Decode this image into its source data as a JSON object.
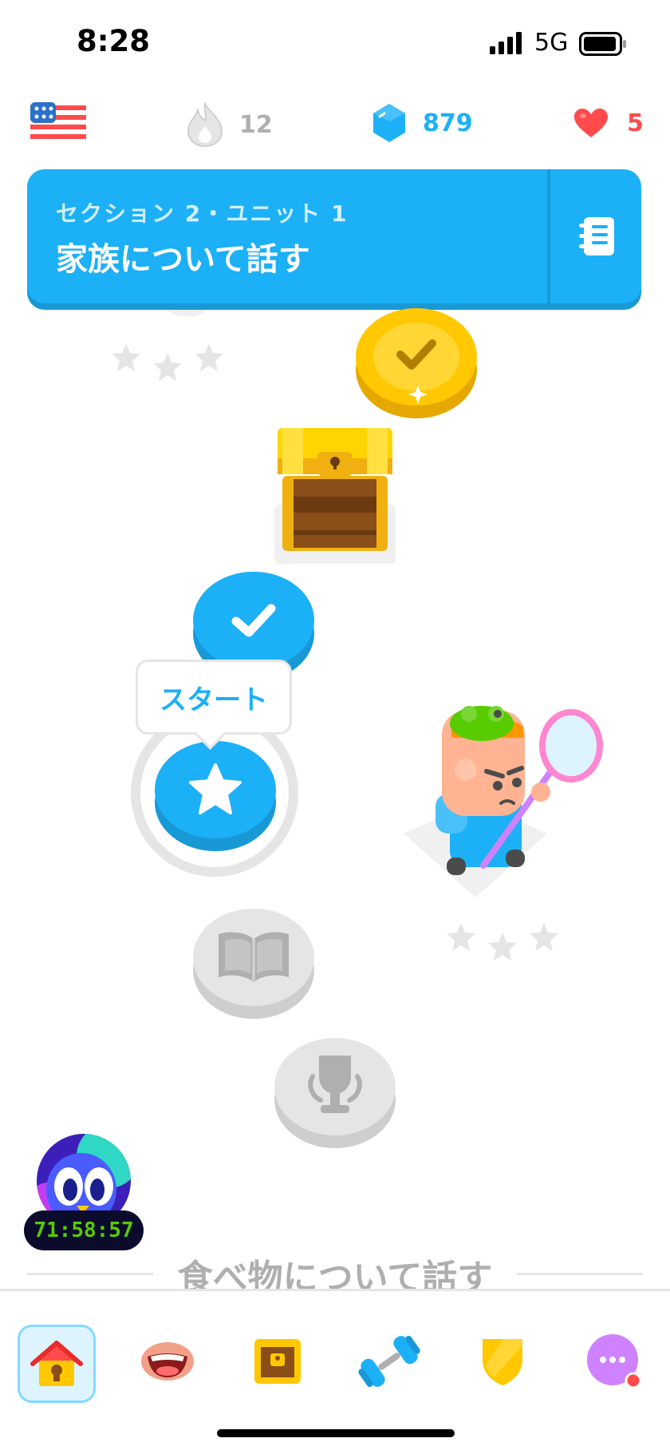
{
  "status_bar": {
    "time": "8:28",
    "network": "5G"
  },
  "top_stats": {
    "language_flag": "us-flag-icon",
    "streak": "12",
    "gems": "879",
    "hearts": "5"
  },
  "unit_header": {
    "section_label": "セクション 2・ユニット 1",
    "title": "家族について話す",
    "guide_icon": "notebook-icon"
  },
  "path": {
    "tooltip_label": "スタート"
  },
  "timer": "71:58:57",
  "next_section_title": "食べ物について話す",
  "bottom_nav": [
    {
      "name": "home",
      "icon": "house-icon",
      "active": true
    },
    {
      "name": "speak",
      "icon": "mouth-icon",
      "active": false
    },
    {
      "name": "shop",
      "icon": "chest-icon",
      "active": false
    },
    {
      "name": "practice",
      "icon": "dumbbell-icon",
      "active": false
    },
    {
      "name": "leagues",
      "icon": "shield-icon",
      "active": false
    },
    {
      "name": "more",
      "icon": "more-icon",
      "active": false
    }
  ],
  "colors": {
    "brand_blue": "#1cb0f6",
    "gold": "#ffc800",
    "gray_node": "#e5e5e5",
    "heart_red": "#ff4b4b"
  }
}
